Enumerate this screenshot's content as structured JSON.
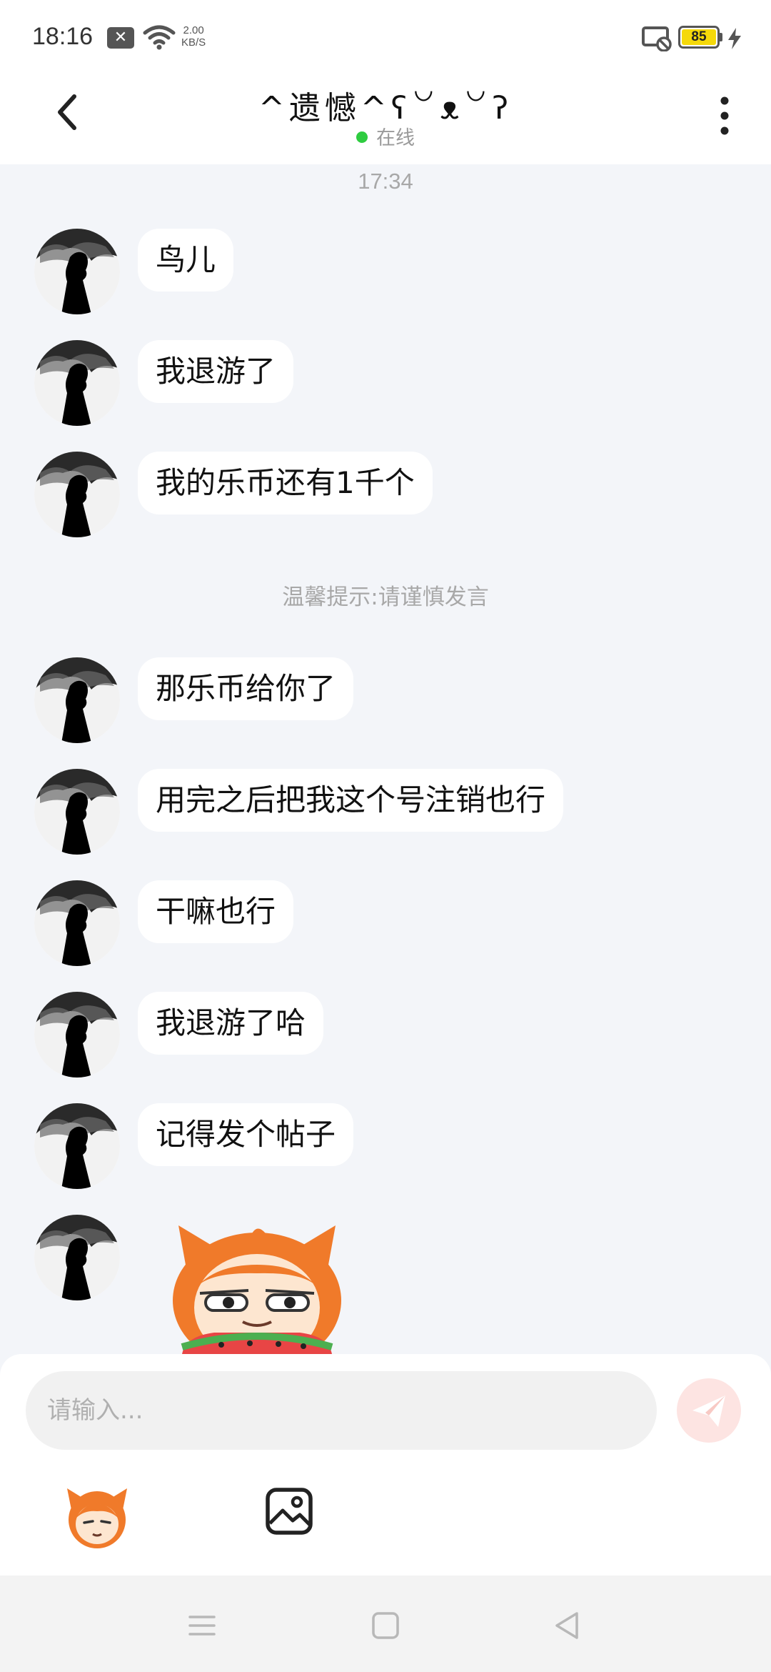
{
  "status_bar": {
    "time": "18:16",
    "notification_icon": "x-box-icon",
    "network_speed_value": "2.00",
    "network_speed_unit": "KB/S",
    "battery_level": "85",
    "battery_color": "#f5d90a"
  },
  "header": {
    "title": "^遗憾^ʕ꒡ᴥ꒡ʔ",
    "presence": "在线",
    "presence_color": "#2ecc40"
  },
  "conversation": {
    "timestamp": "17:34",
    "system_hint": "温馨提示:请谨慎发言",
    "messages_before_hint": [
      {
        "text": "鸟儿"
      },
      {
        "text": "我退游了"
      },
      {
        "text": "我的乐币还有1千个"
      }
    ],
    "messages_after_hint": [
      {
        "text": "那乐币给你了"
      },
      {
        "text": "用完之后把我这个号注销也行"
      },
      {
        "text": "干嘛也行"
      },
      {
        "text": "我退游了哈"
      },
      {
        "text": "记得发个帖子"
      }
    ],
    "last_message_type": "sticker"
  },
  "composer": {
    "placeholder": "请输入...",
    "send_icon": "paper-plane-icon",
    "sticker_icon": "sticker-face-icon",
    "image_icon": "image-icon"
  },
  "nav_bar": {
    "icons": [
      "menu-icon",
      "home-square-icon",
      "back-triangle-icon"
    ]
  }
}
